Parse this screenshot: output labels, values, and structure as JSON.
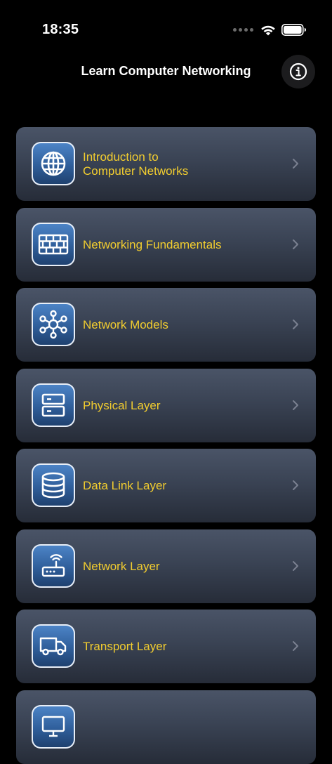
{
  "status": {
    "time": "18:35"
  },
  "header": {
    "title": "Learn Computer Networking"
  },
  "topics": [
    {
      "label": "Introduction to\nComputer Networks",
      "icon": "globe-icon"
    },
    {
      "label": "Networking Fundamentals",
      "icon": "firewall-icon"
    },
    {
      "label": "Network Models",
      "icon": "network-hub-icon"
    },
    {
      "label": "Physical Layer",
      "icon": "server-icon"
    },
    {
      "label": "Data Link Layer",
      "icon": "database-icon"
    },
    {
      "label": "Network Layer",
      "icon": "router-icon"
    },
    {
      "label": "Transport Layer",
      "icon": "truck-icon"
    },
    {
      "label": "",
      "icon": "monitor-icon"
    }
  ],
  "colors": {
    "accent_text": "#f2cd2f",
    "card": "#3a4354",
    "icon_tile": "#2f5e9a"
  }
}
